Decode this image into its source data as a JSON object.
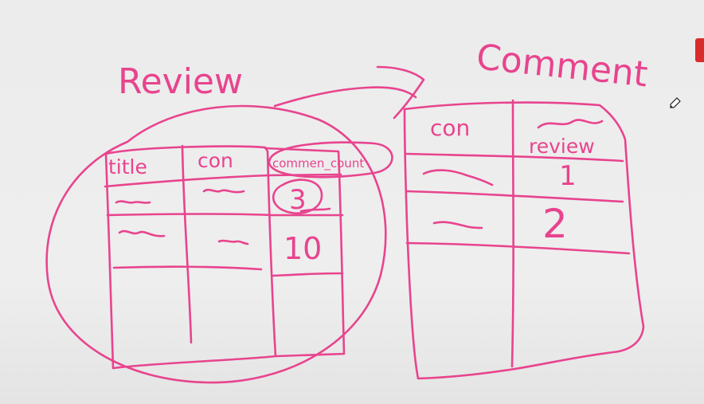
{
  "colors": {
    "ink": "#e8448e",
    "background": "#ececec",
    "tab": "#d92c2c"
  },
  "icons": {
    "cursor": "pencil-icon"
  },
  "review": {
    "title": "Review",
    "headers": [
      "title",
      "con",
      "commen_count"
    ],
    "rows": [
      {
        "title": "~",
        "con": "~",
        "comment_count": "3"
      },
      {
        "title": "~",
        "con": "~",
        "comment_count": "10"
      }
    ]
  },
  "comment": {
    "title": "Comment",
    "headers": [
      "con",
      "review"
    ],
    "rows": [
      {
        "con": "~",
        "review": "1"
      },
      {
        "con": "~",
        "review": "2"
      }
    ]
  }
}
